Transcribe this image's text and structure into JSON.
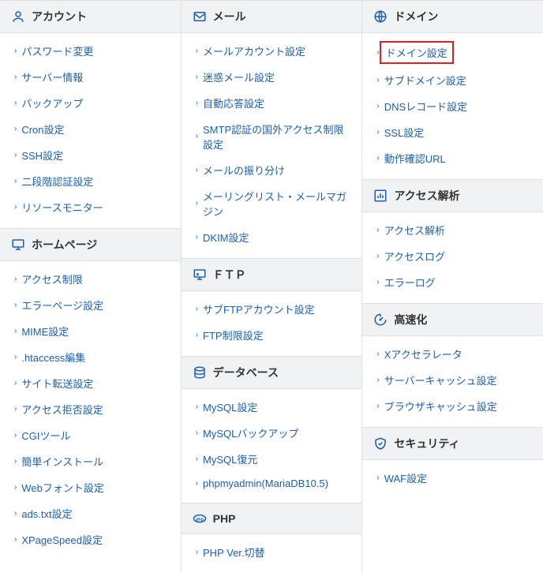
{
  "cols": [
    {
      "sections": [
        {
          "icon": "user-icon",
          "title": "アカウント",
          "items": [
            {
              "label": "パスワード変更"
            },
            {
              "label": "サーバー情報"
            },
            {
              "label": "バックアップ"
            },
            {
              "label": "Cron設定"
            },
            {
              "label": "SSH設定"
            },
            {
              "label": "二段階認証設定"
            },
            {
              "label": "リソースモニター"
            }
          ]
        },
        {
          "icon": "display-icon",
          "title": "ホームページ",
          "items": [
            {
              "label": "アクセス制限"
            },
            {
              "label": "エラーページ設定"
            },
            {
              "label": "MIME設定"
            },
            {
              "label": ".htaccess編集"
            },
            {
              "label": "サイト転送設定"
            },
            {
              "label": "アクセス拒否設定"
            },
            {
              "label": "CGIツール"
            },
            {
              "label": "簡単インストール"
            },
            {
              "label": "Webフォント設定"
            },
            {
              "label": "ads.txt設定"
            },
            {
              "label": "XPageSpeed設定"
            }
          ]
        }
      ]
    },
    {
      "sections": [
        {
          "icon": "mail-icon",
          "title": "メール",
          "items": [
            {
              "label": "メールアカウント設定"
            },
            {
              "label": "迷惑メール設定"
            },
            {
              "label": "自動応答設定"
            },
            {
              "label": "SMTP認証の国外アクセス制限設定"
            },
            {
              "label": "メールの振り分け"
            },
            {
              "label": "メーリングリスト・メールマガジン"
            },
            {
              "label": "DKIM設定"
            }
          ]
        },
        {
          "icon": "ftp-icon",
          "title": "ＦＴＰ",
          "items": [
            {
              "label": "サブFTPアカウント設定"
            },
            {
              "label": "FTP制限設定"
            }
          ]
        },
        {
          "icon": "database-icon",
          "title": "データベース",
          "items": [
            {
              "label": "MySQL設定"
            },
            {
              "label": "MySQLバックアップ"
            },
            {
              "label": "MySQL復元"
            },
            {
              "label": "phpmyadmin(MariaDB10.5)"
            }
          ]
        },
        {
          "icon": "php-icon",
          "title": "PHP",
          "items": [
            {
              "label": "PHP Ver.切替"
            }
          ]
        }
      ]
    },
    {
      "sections": [
        {
          "icon": "globe-icon",
          "title": "ドメイン",
          "items": [
            {
              "label": "ドメイン設定",
              "highlight": true
            },
            {
              "label": "サブドメイン設定"
            },
            {
              "label": "DNSレコード設定"
            },
            {
              "label": "SSL設定"
            },
            {
              "label": "動作確認URL"
            }
          ]
        },
        {
          "icon": "chart-icon",
          "title": "アクセス解析",
          "items": [
            {
              "label": "アクセス解析"
            },
            {
              "label": "アクセスログ"
            },
            {
              "label": "エラーログ"
            }
          ]
        },
        {
          "icon": "speed-icon",
          "title": "高速化",
          "items": [
            {
              "label": "Xアクセラレータ"
            },
            {
              "label": "サーバーキャッシュ設定"
            },
            {
              "label": "ブラウザキャッシュ設定"
            }
          ]
        },
        {
          "icon": "shield-icon",
          "title": "セキュリティ",
          "items": [
            {
              "label": "WAF設定"
            }
          ]
        }
      ]
    }
  ]
}
